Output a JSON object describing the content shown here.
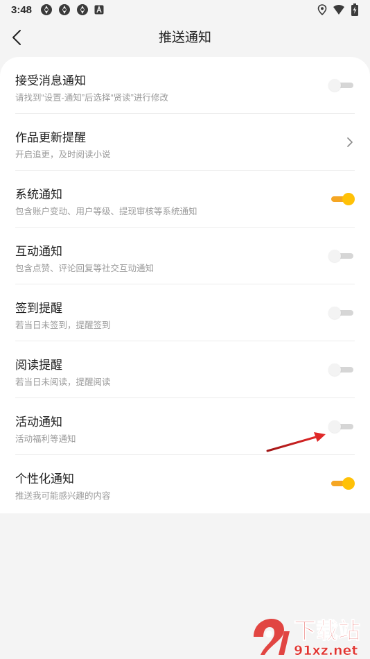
{
  "status_bar": {
    "time": "3:48",
    "left_icons": [
      "app-notification-icon",
      "app-notification-icon",
      "app-notification-icon",
      "font-a-icon"
    ],
    "right_icons": [
      "location-icon",
      "wifi-icon",
      "battery-charging-icon"
    ]
  },
  "header": {
    "title": "推送通知",
    "back_icon": "chevron-left-icon"
  },
  "settings": [
    {
      "title": "接受消息通知",
      "subtitle": "请找到“设置-通知”后选择“贤读”进行修改",
      "control": "toggle",
      "enabled": false
    },
    {
      "title": "作品更新提醒",
      "subtitle": "开启追更，及时阅读小说",
      "control": "chevron"
    },
    {
      "title": "系统通知",
      "subtitle": "包含账户变动、用户等级、提现审核等系统通知",
      "control": "toggle",
      "enabled": true
    },
    {
      "title": "互动通知",
      "subtitle": "包含点赞、评论回复等社交互动通知",
      "control": "toggle",
      "enabled": false
    },
    {
      "title": "签到提醒",
      "subtitle": "若当日未签到，提醒签到",
      "control": "toggle",
      "enabled": false
    },
    {
      "title": "阅读提醒",
      "subtitle": "若当日未阅读，提醒阅读",
      "control": "toggle",
      "enabled": false
    },
    {
      "title": "活动通知",
      "subtitle": "活动福利等通知",
      "control": "toggle",
      "enabled": false
    },
    {
      "title": "个性化通知",
      "subtitle": "推送我可能感兴趣的内容",
      "control": "toggle",
      "enabled": true
    }
  ],
  "colors": {
    "toggle_on_track": "#f5a623",
    "toggle_on_knob": "#ffc107",
    "toggle_off_track": "#d6d6d6",
    "toggle_off_knob": "#f3f3f3",
    "annotation_arrow": "#d42020",
    "watermark": "#e0332f"
  },
  "watermark": {
    "text_main": "下载站",
    "text_domain": "91xz.net"
  }
}
